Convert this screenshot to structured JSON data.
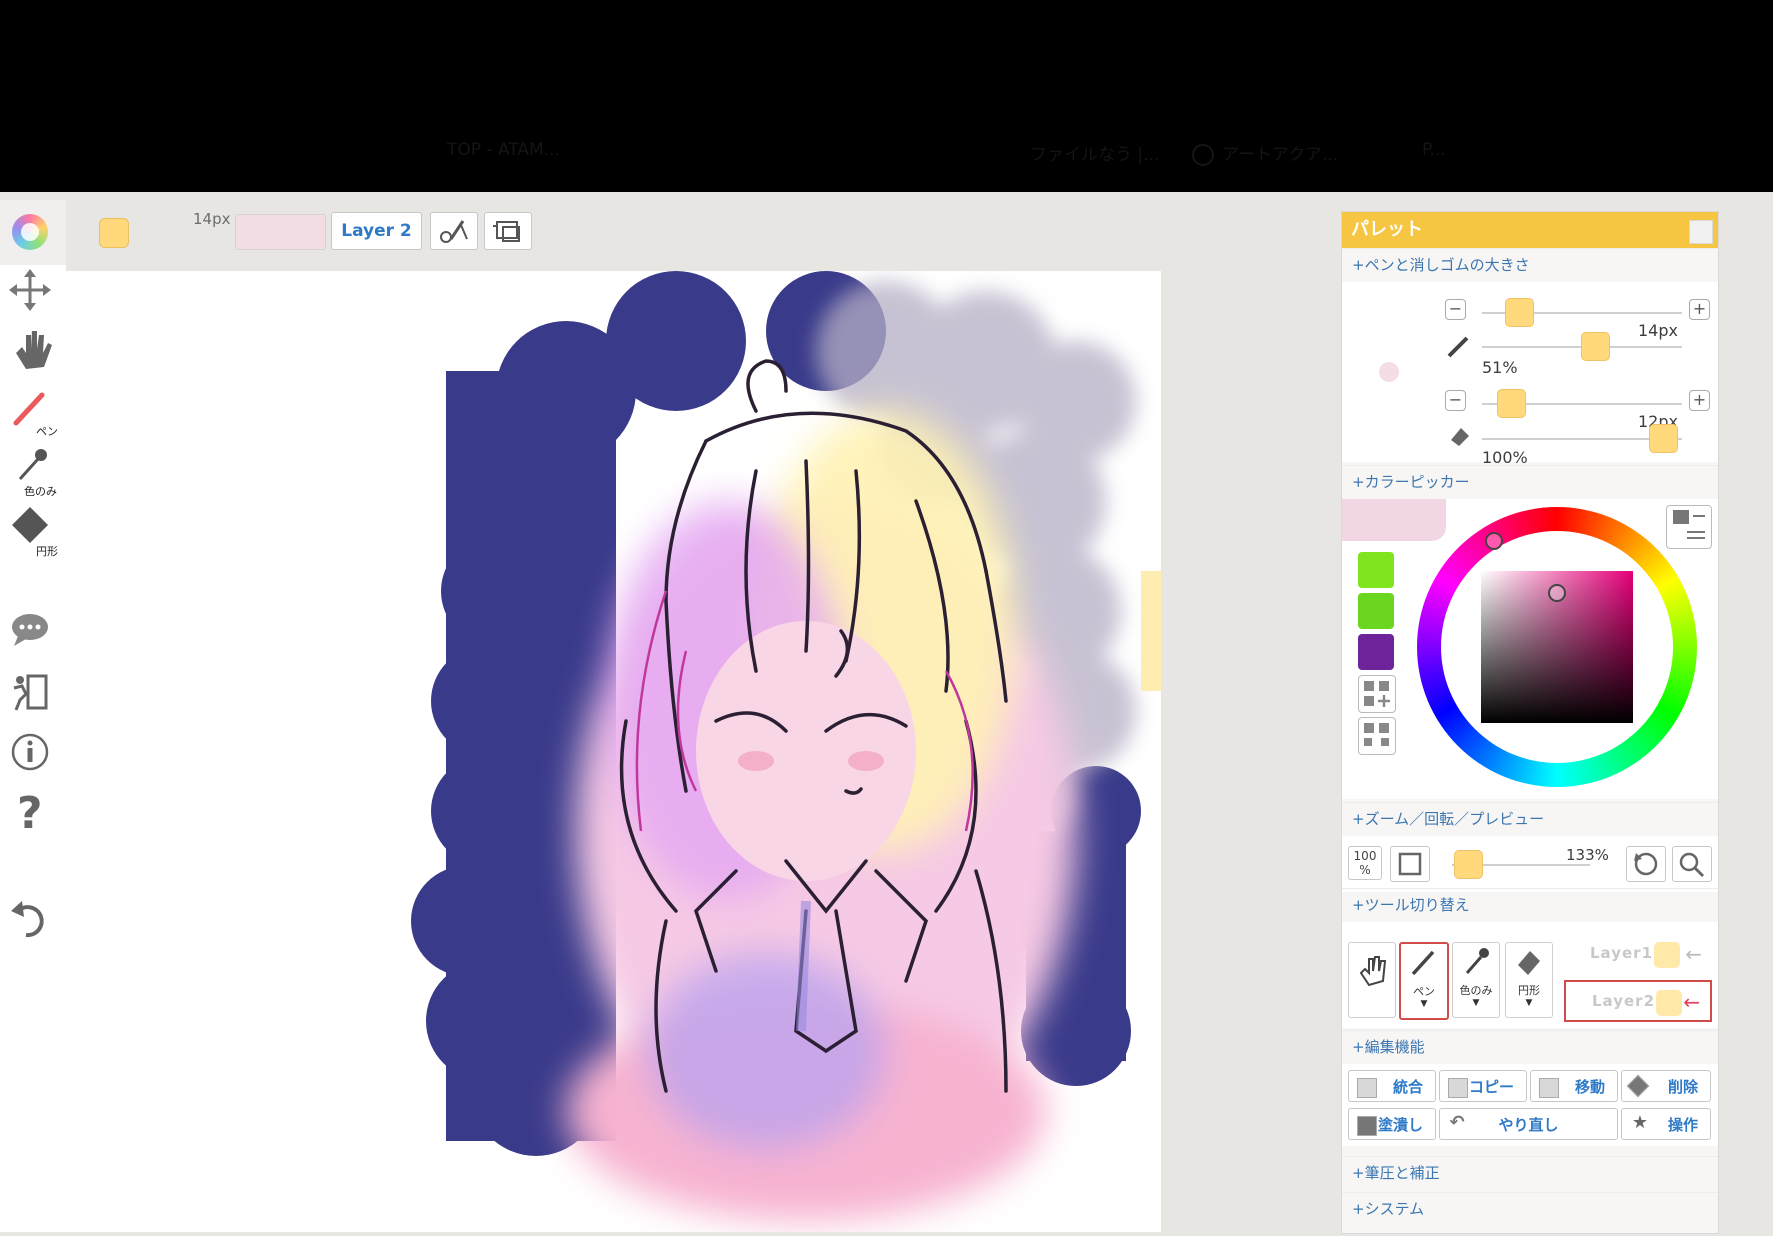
{
  "browser": {
    "tabs": [
      "TOP - ATAM...",
      "ファイルなう |...",
      "アートアクア...",
      "P..."
    ]
  },
  "toolbar": {
    "current_color": "#ffd97b",
    "size_label": "14px",
    "layer_button_label": "Layer 2"
  },
  "side_tools": {
    "pen_label": "ペン",
    "dropper_label": "色のみ",
    "eraser_label": "円形"
  },
  "palette": {
    "title": "パレット",
    "sections": {
      "pen_eraser_size": "+ペンと消しゴムの大きさ",
      "color_picker": "+カラーピッカー",
      "zoom": "+ズーム／回転／プレビュー",
      "tool_switch": "+ツール切り替え",
      "edit": "+編集機能",
      "pressure": "+筆圧と補正",
      "system": "+システム"
    },
    "pen_size": {
      "value_label": "14px",
      "level": 0.11
    },
    "pen_opacity": {
      "value_label": "51%",
      "level": 0.51
    },
    "eraser_size": {
      "value_label": "12px",
      "level": 0.09
    },
    "eraser_opacity": {
      "value_label": "100%",
      "level": 1.0
    },
    "color_history": [
      "#7ee51f",
      "#6ad61f",
      "#6d249b"
    ],
    "zoom": {
      "reset_label": "100",
      "reset_unit": "%",
      "value_label": "133%",
      "level": 0.2
    },
    "tool_switch": {
      "pen_label": "ペン",
      "dropper_label": "色のみ",
      "eraser_label": "円形",
      "layers": [
        "Layer1",
        "Layer2"
      ]
    },
    "edit_buttons": [
      "統合",
      "コピー",
      "移動",
      "削除",
      "塗潰し",
      "やり直し",
      "操作"
    ]
  }
}
